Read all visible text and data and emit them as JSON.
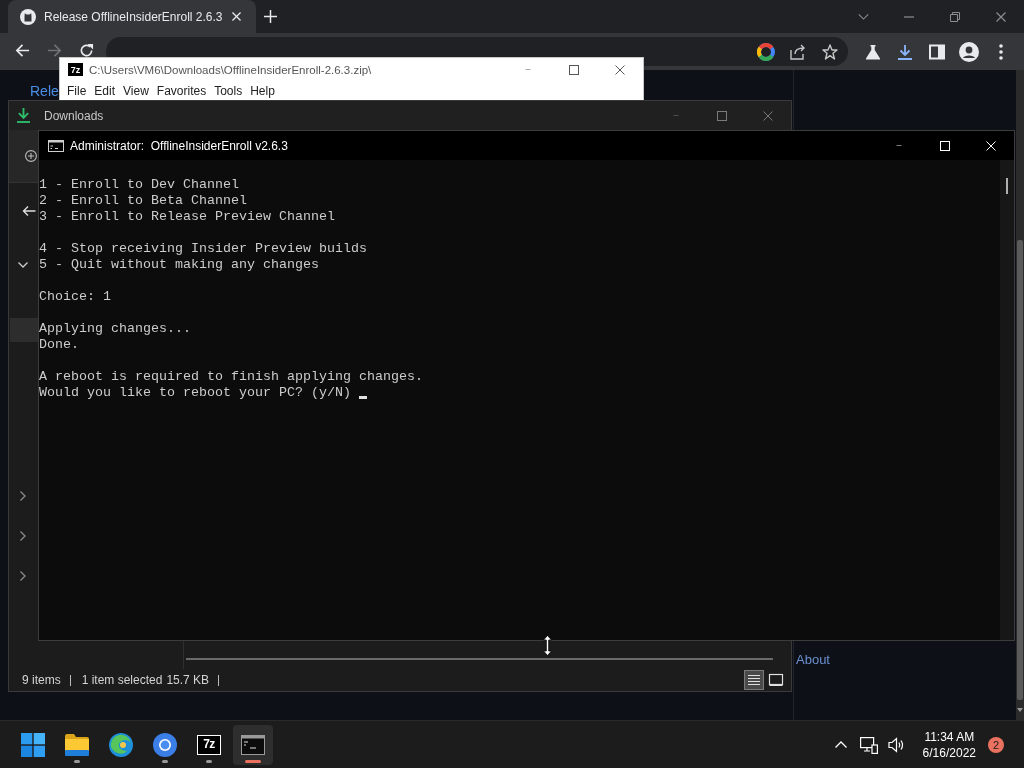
{
  "browser": {
    "tabs": [
      {
        "title": "Release OfflineInsiderEnroll 2.6.3",
        "selected": true
      }
    ],
    "nav_buttons": [
      {
        "kind": "back",
        "disabled": false
      },
      {
        "kind": "forward",
        "disabled": true
      },
      {
        "kind": "reload",
        "disabled": false
      }
    ],
    "page": {
      "link": "Rele",
      "sidebar_link": "About"
    }
  },
  "archive_window": {
    "glyph": "7z",
    "title": "C:\\Users\\VM6\\Downloads\\OfflineInsiderEnroll-2.6.3.zip\\",
    "menu": [
      "File",
      "Edit",
      "View",
      "Favorites",
      "Tools",
      "Help"
    ]
  },
  "explorer_window": {
    "title": "Downloads",
    "nav_pane": [
      {
        "kind": "expander",
        "expanded": true
      },
      {
        "kind": "row",
        "selected": true
      },
      {
        "kind": "expander",
        "expanded": false
      },
      {
        "kind": "expander",
        "expanded": false
      },
      {
        "kind": "expander",
        "expanded": false
      }
    ],
    "status": {
      "item_count": "9 items",
      "selection": "1 item selected",
      "size": "15.7 KB"
    },
    "view_buttons": [
      {
        "kind": "details",
        "selected": true
      },
      {
        "kind": "large_icons",
        "selected": false
      }
    ]
  },
  "console_window": {
    "title": "Administrator:  OfflineInsiderEnroll v2.6.3",
    "blocks": [
      [
        "1 - Enroll to Dev Channel",
        "2 - Enroll to Beta Channel",
        "3 - Enroll to Release Preview Channel"
      ],
      [
        "4 - Stop receiving Insider Preview builds",
        "5 - Quit without making any changes"
      ],
      [
        "Choice: 1"
      ],
      [
        "Applying changes...",
        "Done."
      ],
      [
        "A reboot is required to finish applying changes.",
        "Would you like to reboot your PC? (y/N)"
      ]
    ],
    "cursor": true
  },
  "taskbar": {
    "apps": [
      {
        "kind": "start",
        "running": false,
        "selected": false
      },
      {
        "kind": "files",
        "running": true,
        "selected": false
      },
      {
        "kind": "swirl_browser",
        "running": false,
        "selected": false
      },
      {
        "kind": "ring_browser",
        "running": true,
        "selected": false
      },
      {
        "kind": "archiver",
        "glyph": "7z",
        "running": true,
        "selected": false
      },
      {
        "kind": "terminal",
        "running": true,
        "selected": true
      }
    ],
    "clock": {
      "time": "11:34 AM",
      "date": "6/16/2022"
    },
    "notification_count": "2"
  }
}
